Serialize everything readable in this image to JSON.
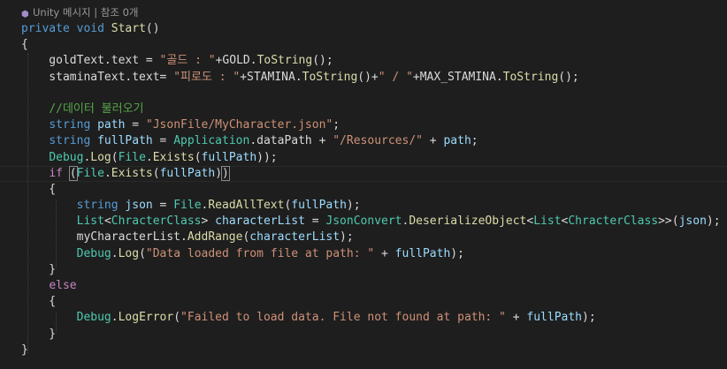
{
  "codelens": {
    "text": "Unity 메시지 | 참조 0개"
  },
  "editor": {
    "lines": [
      [
        {
          "c": "kw",
          "t": "private"
        },
        {
          "c": "id",
          "t": " "
        },
        {
          "c": "kw",
          "t": "void"
        },
        {
          "c": "id",
          "t": " "
        },
        {
          "c": "fn",
          "t": "Start"
        },
        {
          "c": "id",
          "t": "()"
        }
      ],
      [
        {
          "c": "id",
          "t": "{"
        }
      ],
      [
        {
          "c": "id",
          "t": "    goldText.text = "
        },
        {
          "c": "str",
          "t": "\"골드 : \""
        },
        {
          "c": "id",
          "t": "+GOLD."
        },
        {
          "c": "fn",
          "t": "ToString"
        },
        {
          "c": "id",
          "t": "();"
        }
      ],
      [
        {
          "c": "id",
          "t": "    staminaText.text= "
        },
        {
          "c": "str",
          "t": "\"피로도 : \""
        },
        {
          "c": "id",
          "t": "+STAMINA."
        },
        {
          "c": "fn",
          "t": "ToString"
        },
        {
          "c": "id",
          "t": "()+"
        },
        {
          "c": "str",
          "t": "\" / \""
        },
        {
          "c": "id",
          "t": "+MAX_STAMINA."
        },
        {
          "c": "fn",
          "t": "ToString"
        },
        {
          "c": "id",
          "t": "();"
        }
      ],
      [
        {
          "c": "id",
          "t": ""
        }
      ],
      [
        {
          "c": "id",
          "t": "    "
        },
        {
          "c": "cm",
          "t": "//데이터 불러오기"
        }
      ],
      [
        {
          "c": "id",
          "t": "    "
        },
        {
          "c": "kw",
          "t": "string"
        },
        {
          "c": "id",
          "t": " "
        },
        {
          "c": "var",
          "t": "path"
        },
        {
          "c": "id",
          "t": " = "
        },
        {
          "c": "str",
          "t": "\"JsonFile/MyCharacter.json\""
        },
        {
          "c": "id",
          "t": ";"
        }
      ],
      [
        {
          "c": "id",
          "t": "    "
        },
        {
          "c": "kw",
          "t": "string"
        },
        {
          "c": "id",
          "t": " "
        },
        {
          "c": "var",
          "t": "fullPath"
        },
        {
          "c": "id",
          "t": " = "
        },
        {
          "c": "ty",
          "t": "Application"
        },
        {
          "c": "id",
          "t": ".dataPath + "
        },
        {
          "c": "str",
          "t": "\"/Resources/\""
        },
        {
          "c": "id",
          "t": " + "
        },
        {
          "c": "var",
          "t": "path"
        },
        {
          "c": "id",
          "t": ";"
        }
      ],
      [
        {
          "c": "id",
          "t": "    "
        },
        {
          "c": "ty",
          "t": "Debug"
        },
        {
          "c": "id",
          "t": "."
        },
        {
          "c": "fn",
          "t": "Log"
        },
        {
          "c": "id",
          "t": "("
        },
        {
          "c": "ty",
          "t": "File"
        },
        {
          "c": "id",
          "t": "."
        },
        {
          "c": "fn",
          "t": "Exists"
        },
        {
          "c": "id",
          "t": "("
        },
        {
          "c": "var",
          "t": "fullPath"
        },
        {
          "c": "id",
          "t": "));"
        }
      ],
      [
        {
          "c": "id",
          "t": "    "
        },
        {
          "c": "kw2",
          "t": "if"
        },
        {
          "c": "id",
          "t": " "
        },
        {
          "c": "br",
          "t": "("
        },
        {
          "c": "ty",
          "t": "File"
        },
        {
          "c": "id",
          "t": "."
        },
        {
          "c": "fn",
          "t": "Exists"
        },
        {
          "c": "id",
          "t": "("
        },
        {
          "c": "var",
          "t": "fullPath"
        },
        {
          "c": "id",
          "t": ")"
        },
        {
          "c": "br",
          "t": ")"
        }
      ],
      [
        {
          "c": "id",
          "t": "    {"
        }
      ],
      [
        {
          "c": "id",
          "t": "        "
        },
        {
          "c": "kw",
          "t": "string"
        },
        {
          "c": "id",
          "t": " "
        },
        {
          "c": "var",
          "t": "json"
        },
        {
          "c": "id",
          "t": " = "
        },
        {
          "c": "ty",
          "t": "File"
        },
        {
          "c": "id",
          "t": "."
        },
        {
          "c": "fn",
          "t": "ReadAllText"
        },
        {
          "c": "id",
          "t": "("
        },
        {
          "c": "var",
          "t": "fullPath"
        },
        {
          "c": "id",
          "t": ");"
        }
      ],
      [
        {
          "c": "id",
          "t": "        "
        },
        {
          "c": "ty",
          "t": "List"
        },
        {
          "c": "id",
          "t": "<"
        },
        {
          "c": "ty",
          "t": "ChracterClass"
        },
        {
          "c": "id",
          "t": "> "
        },
        {
          "c": "var",
          "t": "characterList"
        },
        {
          "c": "id",
          "t": " = "
        },
        {
          "c": "ty",
          "t": "JsonConvert"
        },
        {
          "c": "id",
          "t": "."
        },
        {
          "c": "fn",
          "t": "DeserializeObject"
        },
        {
          "c": "id",
          "t": "<"
        },
        {
          "c": "ty",
          "t": "List"
        },
        {
          "c": "id",
          "t": "<"
        },
        {
          "c": "ty",
          "t": "ChracterClass"
        },
        {
          "c": "id",
          "t": ">>("
        },
        {
          "c": "var",
          "t": "json"
        },
        {
          "c": "id",
          "t": ");"
        }
      ],
      [
        {
          "c": "id",
          "t": "        myCharacterList."
        },
        {
          "c": "fn",
          "t": "AddRange"
        },
        {
          "c": "id",
          "t": "("
        },
        {
          "c": "var",
          "t": "characterList"
        },
        {
          "c": "id",
          "t": ");"
        }
      ],
      [
        {
          "c": "id",
          "t": "        "
        },
        {
          "c": "ty",
          "t": "Debug"
        },
        {
          "c": "id",
          "t": "."
        },
        {
          "c": "fn",
          "t": "Log"
        },
        {
          "c": "id",
          "t": "("
        },
        {
          "c": "str",
          "t": "\"Data loaded from file at path: \""
        },
        {
          "c": "id",
          "t": " + "
        },
        {
          "c": "var",
          "t": "fullPath"
        },
        {
          "c": "id",
          "t": ");"
        }
      ],
      [
        {
          "c": "id",
          "t": "    }"
        }
      ],
      [
        {
          "c": "id",
          "t": "    "
        },
        {
          "c": "kw2",
          "t": "else"
        }
      ],
      [
        {
          "c": "id",
          "t": "    {"
        }
      ],
      [
        {
          "c": "id",
          "t": "        "
        },
        {
          "c": "ty",
          "t": "Debug"
        },
        {
          "c": "id",
          "t": "."
        },
        {
          "c": "fn",
          "t": "LogError"
        },
        {
          "c": "id",
          "t": "("
        },
        {
          "c": "str",
          "t": "\"Failed to load data. File not found at path: \""
        },
        {
          "c": "id",
          "t": " + "
        },
        {
          "c": "var",
          "t": "fullPath"
        },
        {
          "c": "id",
          "t": ");"
        }
      ],
      [
        {
          "c": "id",
          "t": "    }"
        }
      ],
      [
        {
          "c": "id",
          "t": "}"
        }
      ]
    ]
  },
  "colors": {
    "background": "#1e1e1e",
    "keyword": "#569cd6",
    "control_keyword": "#c586c0",
    "type": "#4ec9b0",
    "method": "#dcdcaa",
    "string": "#ce9178",
    "comment": "#57a64a",
    "identifier": "#dadada",
    "variable": "#9cdcfe"
  }
}
